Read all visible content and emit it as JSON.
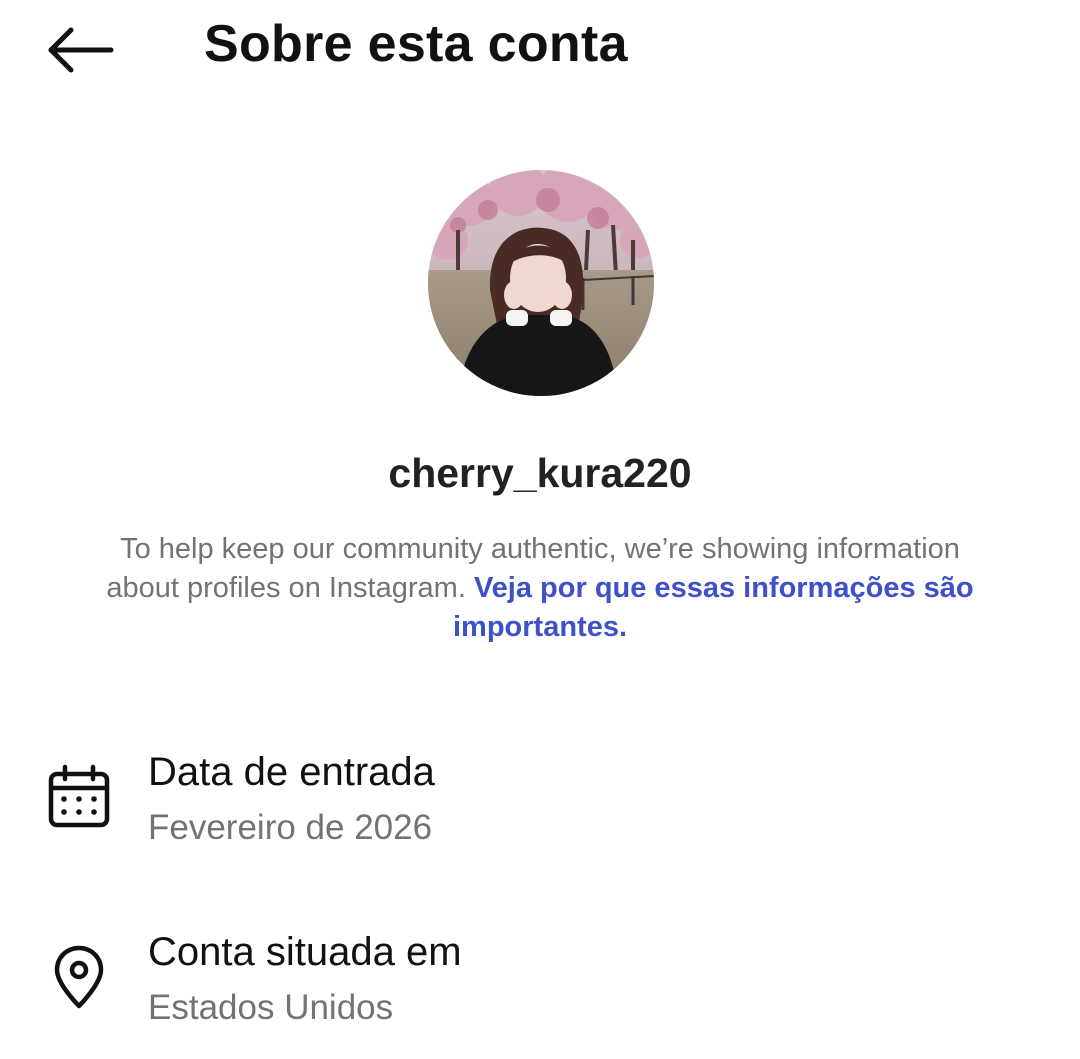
{
  "header": {
    "title": "Sobre esta conta",
    "back_icon": "arrow-left-icon"
  },
  "profile": {
    "username": "cherry_kura220",
    "avatar_description_icon": "profile-photo"
  },
  "info": {
    "text": "To help keep our community authentic, we’re showing information about profiles on Instagram. ",
    "link_text": "Veja por que essas informações são importantes.",
    "link_color": "#3f51c8"
  },
  "rows": [
    {
      "icon": "calendar-icon",
      "label": "Data de entrada",
      "value": "Fevereiro de 2026"
    },
    {
      "icon": "location-pin-icon",
      "label": "Conta situada em",
      "value": "Estados Unidos"
    }
  ]
}
